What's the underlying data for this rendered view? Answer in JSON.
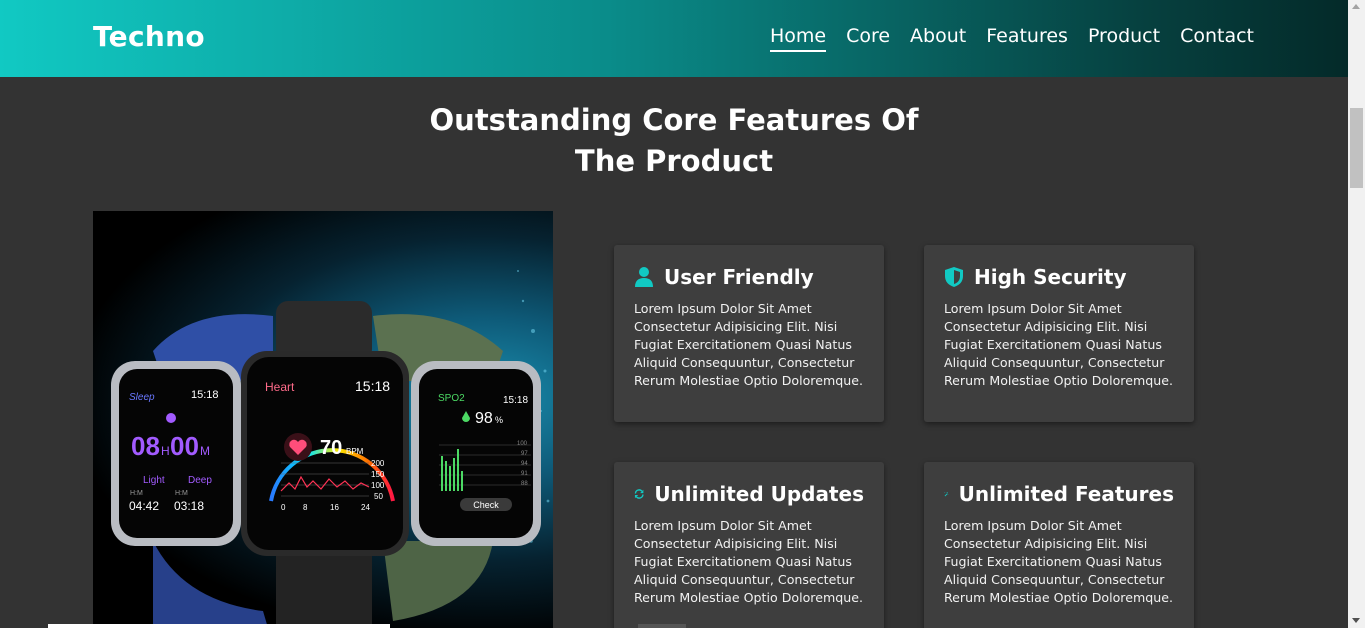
{
  "navbar": {
    "brand": "Techno",
    "links": [
      "Home",
      "Core",
      "About",
      "Features",
      "Product",
      "Contact"
    ],
    "active": "Home"
  },
  "section": {
    "title_line1": "Outstanding Core Features Of",
    "title_line2": "The Product"
  },
  "watch": {
    "left": {
      "label": "Sleep",
      "time": "15:18",
      "sleep_h": "08",
      "sleep_h_unit": "H",
      "sleep_m": "00",
      "sleep_m_unit": "M",
      "light_label": "Light",
      "deep_label": "Deep",
      "unit_label": "H:M",
      "light_value": "04:42",
      "deep_value": "03:18"
    },
    "center": {
      "label": "Heart",
      "time": "15:18",
      "bpm": "70",
      "bpm_unit": "BPM",
      "scale": [
        "200",
        "150",
        "100",
        "50"
      ],
      "axis": [
        "0",
        "8",
        "16",
        "24"
      ]
    },
    "right": {
      "label": "SPO2",
      "time": "15:18",
      "value": "98",
      "unit": "%",
      "scale": [
        "100",
        "97",
        "94",
        "91",
        "88"
      ],
      "button": "Check"
    }
  },
  "cards": [
    {
      "title": "User Friendly",
      "icon": "user-icon",
      "text": "Lorem Ipsum Dolor Sit Amet Consectetur Adipisicing Elit. Nisi Fugiat Exercitationem Quasi Natus Aliquid Consequuntur, Consectetur Rerum Molestiae Optio Doloremque."
    },
    {
      "title": "High Security",
      "icon": "shield-icon",
      "text": "Lorem Ipsum Dolor Sit Amet Consectetur Adipisicing Elit. Nisi Fugiat Exercitationem Quasi Natus Aliquid Consequuntur, Consectetur Rerum Molestiae Optio Doloremque."
    },
    {
      "title": "Unlimited Updates",
      "icon": "refresh-icon",
      "text": "Lorem Ipsum Dolor Sit Amet Consectetur Adipisicing Elit. Nisi Fugiat Exercitationem Quasi Natus Aliquid Consequuntur, Consectetur Rerum Molestiae Optio Doloremque."
    },
    {
      "title": "Unlimited Features",
      "icon": "magic-wand-icon",
      "text": "Lorem Ipsum Dolor Sit Amet Consectetur Adipisicing Elit. Nisi Fugiat Exercitationem Quasi Natus Aliquid Consequuntur, Consectetur Rerum Molestiae Optio Doloremque."
    }
  ],
  "colors": {
    "accent": "#11c9c3",
    "background": "#333333",
    "card": "#3e3e3e"
  }
}
